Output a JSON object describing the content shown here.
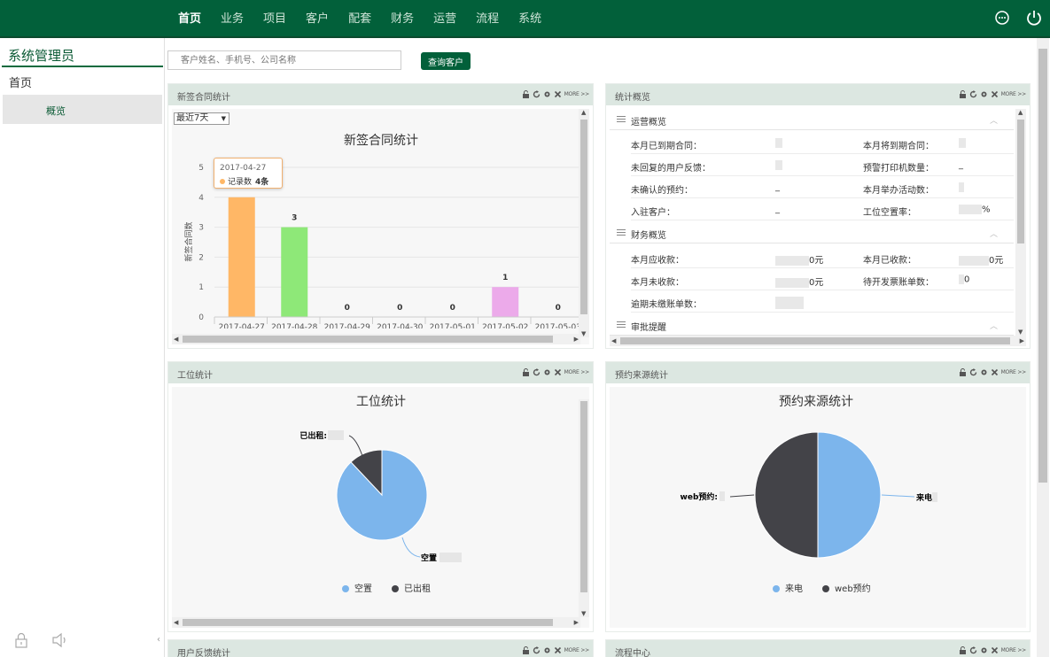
{
  "nav": {
    "items": [
      "首页",
      "业务",
      "项目",
      "客户",
      "配套",
      "财务",
      "运营",
      "流程",
      "系统"
    ],
    "active_index": 0
  },
  "sidebar": {
    "user": "系统管理员",
    "home": "首页",
    "sub_item": "概览"
  },
  "search": {
    "placeholder": "客户姓名、手机号、公司名称",
    "button": "查询客户"
  },
  "panels": {
    "contract": {
      "title": "新签合同统计"
    },
    "stats": {
      "title": "统计概览"
    },
    "station": {
      "title": "工位统计"
    },
    "source": {
      "title": "预约来源统计"
    },
    "feedback": {
      "title": "用户反馈统计"
    },
    "flow": {
      "title": "流程中心"
    }
  },
  "tool_more": "MORE >>",
  "contract_chart": {
    "range_select": "最近7天",
    "tooltip": {
      "date": "2017-04-27",
      "series": "记录数",
      "value": "4条"
    }
  },
  "stats": {
    "sections": [
      {
        "name": "运营概览",
        "rows": [
          {
            "k1": "本月已到期合同：",
            "v1": "",
            "k2": "本月将到期合同：",
            "v2": ""
          },
          {
            "k1": "未回复的用户反馈：",
            "v1": "",
            "k2": "预警打印机数量：",
            "v2": "_"
          },
          {
            "k1": "未确认的预约：",
            "v1": "_",
            "k2": "本月举办活动数：",
            "v2": ""
          },
          {
            "k1": "入驻客户：",
            "v1": "_",
            "k2": "工位空置率：",
            "v2": "%"
          }
        ]
      },
      {
        "name": "财务概览",
        "rows": [
          {
            "k1": "本月应收款：",
            "v1": "0元",
            "k2": "本月已收款：",
            "v2": "0元"
          },
          {
            "k1": "本月未收款：",
            "v1": "0元",
            "k2": "待开发票账单数：",
            "v2": "0"
          },
          {
            "k1": "逾期未缴账单数：",
            "v1": "",
            "k2": "",
            "v2": ""
          }
        ]
      },
      {
        "name": "审批提醒",
        "rows": []
      }
    ]
  },
  "colors": {
    "brand": "#02603a",
    "panel_head": "#dce7e1",
    "pie_blue": "#7cb5ec",
    "pie_dark": "#434348"
  },
  "chart_data": [
    {
      "type": "bar",
      "title": "新签合同统计",
      "ylabel": "新签合同数",
      "categories": [
        "2017-04-27",
        "2017-04-28",
        "2017-04-29",
        "2017-04-30",
        "2017-05-01",
        "2017-05-02",
        "2017-05-03"
      ],
      "values": [
        4,
        3,
        0,
        0,
        0,
        1,
        0
      ],
      "data_labels": [
        "",
        "3",
        "0",
        "0",
        "0",
        "1",
        "0"
      ],
      "colors": [
        "#ffb766",
        "#8ee878",
        "#7cb5ec",
        "#7cb5ec",
        "#7cb5ec",
        "#ecaaea",
        "#7cb5ec"
      ],
      "y_ticks": [
        "0",
        "1",
        "2",
        "3",
        "4",
        "5"
      ],
      "ylim": [
        0,
        5
      ],
      "grid": true
    },
    {
      "type": "pie",
      "title": "工位统计",
      "slices": [
        {
          "name": "空置",
          "value": 88,
          "color": "#7cb5ec",
          "label": "空置"
        },
        {
          "name": "已出租",
          "value": 12,
          "color": "#434348",
          "label": "已出租:"
        }
      ],
      "legend": [
        "空置",
        "已出租"
      ]
    },
    {
      "type": "pie",
      "title": "预约来源统计",
      "slices": [
        {
          "name": "来电",
          "value": 50,
          "color": "#7cb5ec",
          "label": "来电"
        },
        {
          "name": "web预约",
          "value": 50,
          "color": "#434348",
          "label": "web预约:"
        }
      ],
      "legend": [
        "来电",
        "web预约"
      ]
    }
  ]
}
